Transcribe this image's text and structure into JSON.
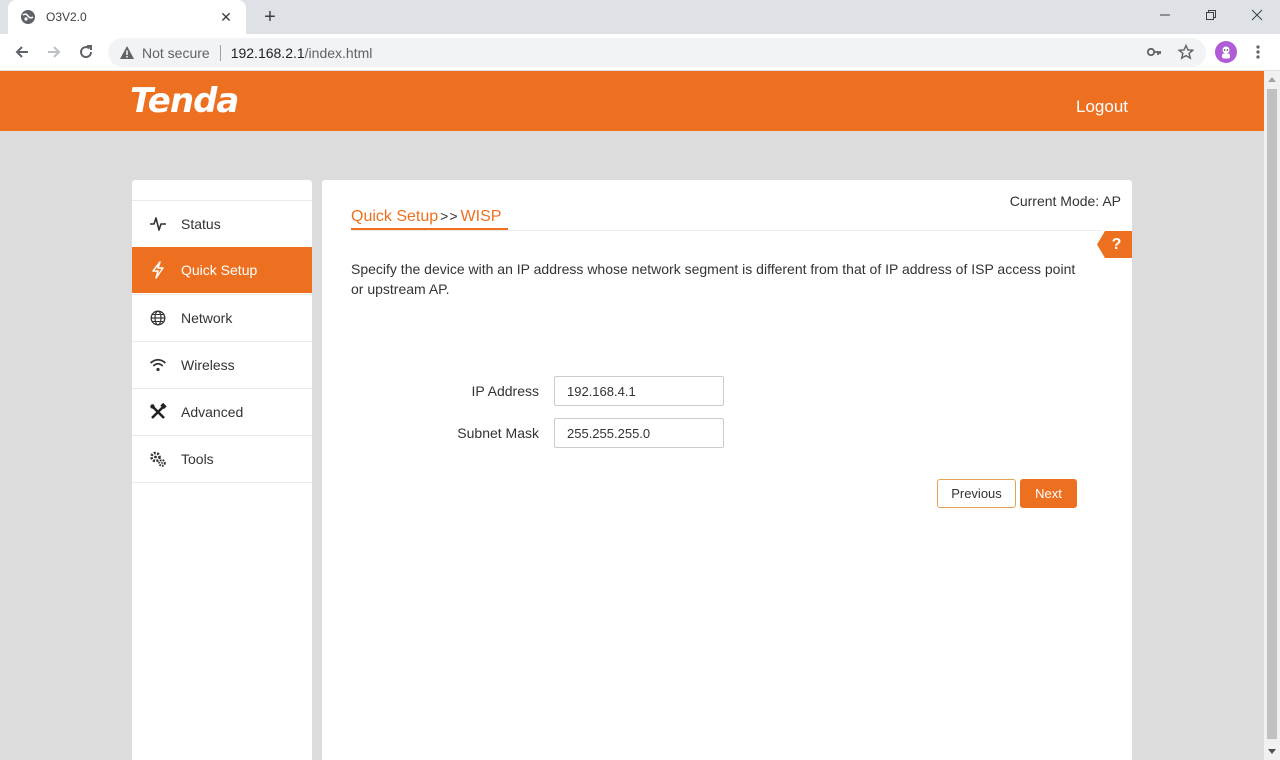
{
  "browser": {
    "tab_title": "O3V2.0",
    "tab_close": "✕",
    "new_tab": "+",
    "not_secure": "Not secure",
    "url_host": "192.168.2.1",
    "url_path": "/index.html"
  },
  "header": {
    "logo": "Tenda",
    "logout": "Logout"
  },
  "sidebar": {
    "items": [
      {
        "label": "Status",
        "icon": "pulse-icon"
      },
      {
        "label": "Quick Setup",
        "icon": "lightning-icon"
      },
      {
        "label": "Network",
        "icon": "globe-icon"
      },
      {
        "label": "Wireless",
        "icon": "wifi-icon"
      },
      {
        "label": "Advanced",
        "icon": "tools-icon"
      },
      {
        "label": "Tools",
        "icon": "gears-icon"
      }
    ],
    "active": "Quick Setup"
  },
  "content": {
    "current_mode": "Current Mode: AP",
    "breadcrumb_root": "Quick Setup",
    "breadcrumb_sep": ">>",
    "breadcrumb_current": "WISP",
    "help": "?",
    "description": "Specify the device with an IP address whose network segment is different from that of IP address of ISP access point or upstream AP.",
    "ip_label": "IP Address",
    "ip_value": "192.168.4.1",
    "mask_label": "Subnet Mask",
    "mask_value": "255.255.255.0",
    "previous": "Previous",
    "next": "Next"
  },
  "colors": {
    "brand": "#ed7020"
  }
}
